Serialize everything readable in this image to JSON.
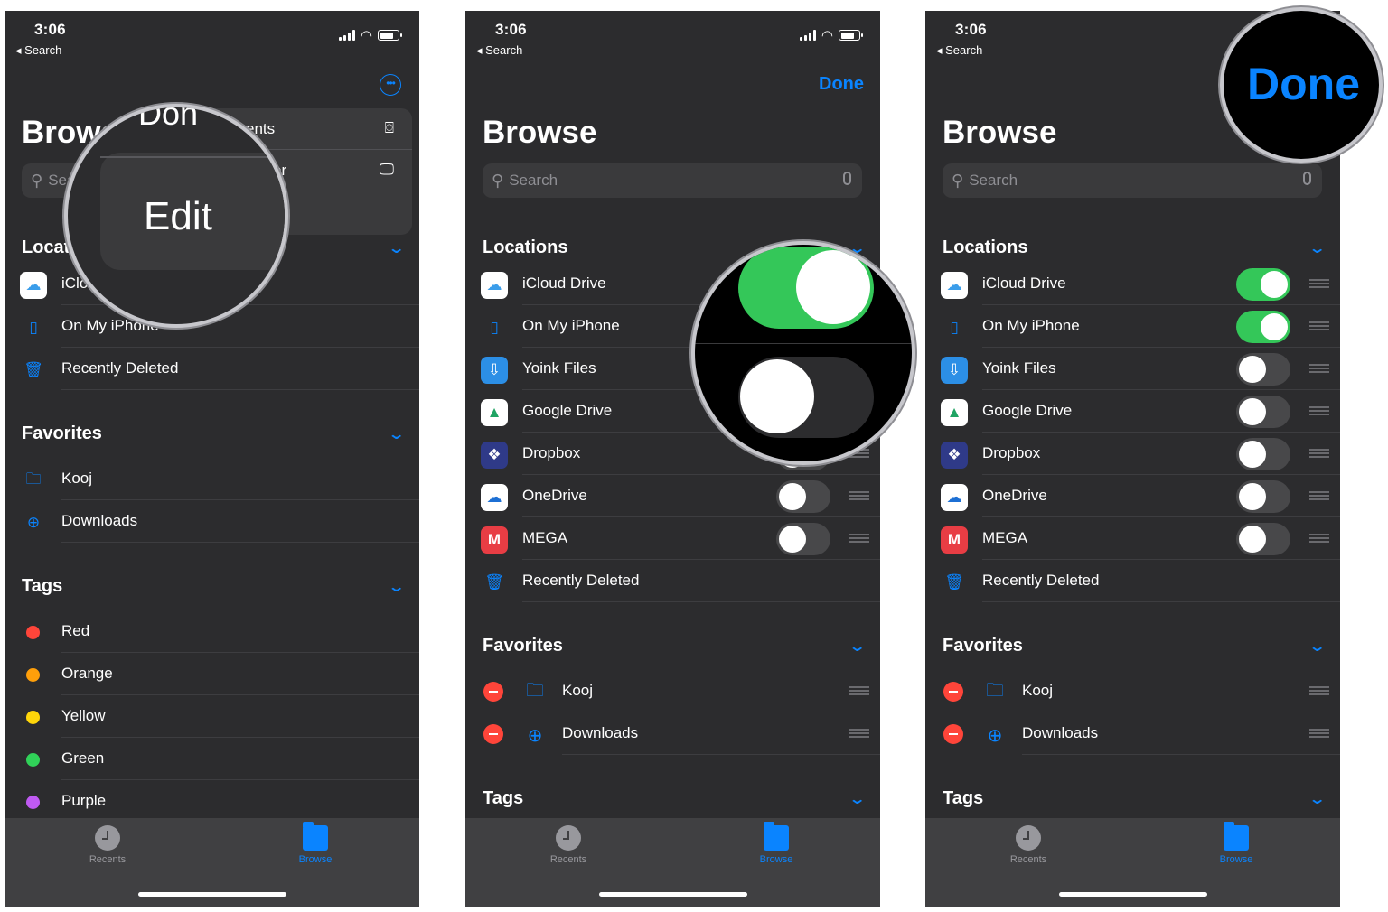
{
  "status": {
    "time": "3:06",
    "back_label": "◂ Search"
  },
  "common": {
    "title": "Browse",
    "search_placeholder": "Search",
    "done_label": "Done",
    "sections": {
      "locations": "Locations",
      "favorites": "Favorites",
      "tags": "Tags"
    },
    "tabs": {
      "recents": "Recents",
      "browse": "Browse"
    }
  },
  "panel1": {
    "popup_items": [
      "ents",
      "er"
    ],
    "magnifier_top_text": "Don",
    "magnifier_label": "Edit",
    "locations": [
      "iClo",
      "On My iPhone",
      "Recently Deleted"
    ],
    "favorites": [
      "Kooj",
      "Downloads"
    ],
    "tags": [
      {
        "label": "Red",
        "color": "#ff453a"
      },
      {
        "label": "Orange",
        "color": "#ff9f0a"
      },
      {
        "label": "Yellow",
        "color": "#ffd60a"
      },
      {
        "label": "Green",
        "color": "#30d158"
      },
      {
        "label": "Purple",
        "color": "#bf5af2"
      }
    ]
  },
  "panel2": {
    "locations": [
      {
        "label": "iCloud Drive",
        "icon": "icloud-icon",
        "toggle": true
      },
      {
        "label": "On My iPhone",
        "icon": "iphone-icon",
        "toggle": true
      },
      {
        "label": "Yoink Files",
        "icon": "yoink-icon",
        "toggle": false
      },
      {
        "label": "Google Drive",
        "icon": "google-drive-icon",
        "toggle": false
      },
      {
        "label": "Dropbox",
        "icon": "dropbox-icon",
        "toggle": false
      },
      {
        "label": "OneDrive",
        "icon": "onedrive-icon",
        "toggle": false
      },
      {
        "label": "MEGA",
        "icon": "mega-icon",
        "toggle": false
      },
      {
        "label": "Recently Deleted",
        "icon": "trash-icon",
        "toggle": null
      }
    ],
    "favorites": [
      "Kooj",
      "Downloads"
    ]
  },
  "panel3": {
    "locations": [
      {
        "label": "iCloud Drive",
        "toggle": true
      },
      {
        "label": "On My iPhone",
        "toggle": true
      },
      {
        "label": "Yoink Files",
        "toggle": false
      },
      {
        "label": "Google Drive",
        "toggle": false
      },
      {
        "label": "Dropbox",
        "toggle": false
      },
      {
        "label": "OneDrive",
        "toggle": false
      },
      {
        "label": "MEGA",
        "toggle": false
      },
      {
        "label": "Recently Deleted",
        "toggle": null
      }
    ],
    "favorites": [
      "Kooj",
      "Downloads"
    ],
    "magnifier_label": "Done"
  },
  "colors": {
    "accent": "#0a84ff",
    "toggle_on": "#34c759",
    "background": "#2c2c2e",
    "delete": "#ff453a"
  }
}
